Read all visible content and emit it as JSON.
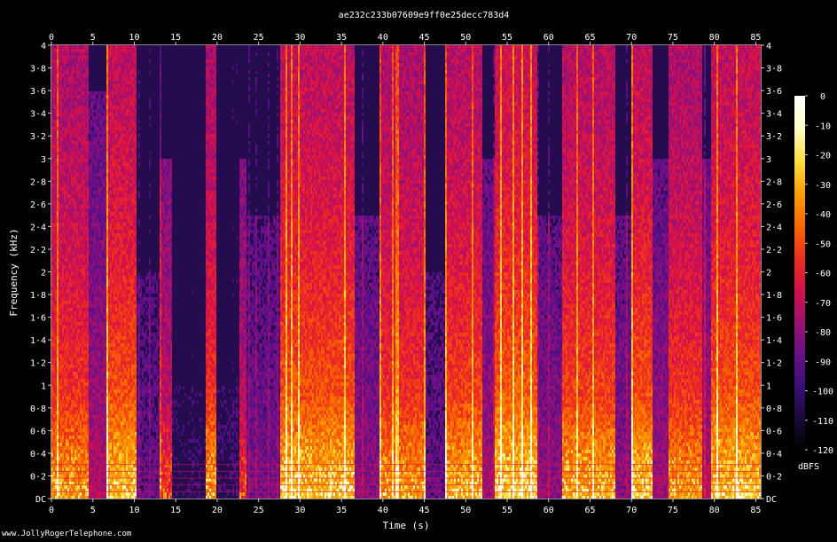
{
  "chart_data": {
    "type": "heatmap",
    "title": "ae232c233b07609e9ff0e25decc783d4",
    "xlabel": "Time (s)",
    "ylabel": "Frequency (kHz)",
    "xlim": [
      0,
      85.6
    ],
    "ylim": [
      0,
      4
    ],
    "x_ticks": [
      "0",
      "5",
      "10",
      "15",
      "20",
      "25",
      "30",
      "35",
      "40",
      "45",
      "50",
      "55",
      "60",
      "65",
      "70",
      "75",
      "80",
      "85"
    ],
    "x_tick_values": [
      0,
      5,
      10,
      15,
      20,
      25,
      30,
      35,
      40,
      45,
      50,
      55,
      60,
      65,
      70,
      75,
      80,
      85
    ],
    "y_ticks": [
      "DC",
      "0·2",
      "0·4",
      "0·6",
      "0·8",
      "1",
      "1·2",
      "1·4",
      "1·6",
      "1·8",
      "2",
      "2·2",
      "2·4",
      "2·6",
      "2·8",
      "3",
      "3·2",
      "3·4",
      "3·6",
      "3·8",
      "4"
    ],
    "y_tick_values": [
      0,
      0.2,
      0.4,
      0.6,
      0.8,
      1,
      1.2,
      1.4,
      1.6,
      1.8,
      2,
      2.2,
      2.4,
      2.6,
      2.8,
      3,
      3.2,
      3.4,
      3.6,
      3.8,
      4
    ],
    "colorbar": {
      "label": "dBFS",
      "ticks": [
        "0",
        "-10",
        "-20",
        "-30",
        "-40",
        "-50",
        "-60",
        "-70",
        "-80",
        "-90",
        "-100",
        "-110",
        "-120"
      ],
      "tick_values": [
        0,
        -10,
        -20,
        -30,
        -40,
        -50,
        -60,
        -70,
        -80,
        -90,
        -100,
        -110,
        -120
      ],
      "range": [
        -120,
        0
      ]
    },
    "colormap": [
      "#000000",
      "#1a0a3a",
      "#3a0f7a",
      "#6a0f8a",
      "#a01070",
      "#d8104a",
      "#f0301a",
      "#f86a00",
      "#fca000",
      "#fde040",
      "#ffffc8",
      "#ffffff"
    ],
    "activity": [
      {
        "start": 0.0,
        "end": 4.3,
        "level": 0.8,
        "peak_khz": 4.0
      },
      {
        "start": 4.3,
        "end": 6.5,
        "level": 0.45,
        "peak_khz": 3.6
      },
      {
        "start": 6.5,
        "end": 10.2,
        "level": 0.9,
        "peak_khz": 4.0
      },
      {
        "start": 10.2,
        "end": 13.0,
        "level": 0.25,
        "peak_khz": 2.0
      },
      {
        "start": 13.0,
        "end": 14.5,
        "level": 0.55,
        "peak_khz": 3.0
      },
      {
        "start": 14.5,
        "end": 18.5,
        "level": 0.1,
        "peak_khz": 1.0
      },
      {
        "start": 18.5,
        "end": 19.8,
        "level": 0.8,
        "peak_khz": 4.0
      },
      {
        "start": 19.8,
        "end": 22.5,
        "level": 0.12,
        "peak_khz": 1.0
      },
      {
        "start": 22.5,
        "end": 23.5,
        "level": 0.55,
        "peak_khz": 3.0
      },
      {
        "start": 23.5,
        "end": 27.5,
        "level": 0.3,
        "peak_khz": 2.5
      },
      {
        "start": 27.5,
        "end": 36.5,
        "level": 0.9,
        "peak_khz": 4.0
      },
      {
        "start": 36.5,
        "end": 39.5,
        "level": 0.35,
        "peak_khz": 2.5
      },
      {
        "start": 39.5,
        "end": 45.0,
        "level": 0.8,
        "peak_khz": 4.0
      },
      {
        "start": 45.0,
        "end": 47.5,
        "level": 0.25,
        "peak_khz": 2.0
      },
      {
        "start": 47.5,
        "end": 52.0,
        "level": 0.85,
        "peak_khz": 4.0
      },
      {
        "start": 52.0,
        "end": 53.3,
        "level": 0.4,
        "peak_khz": 3.0
      },
      {
        "start": 53.3,
        "end": 58.5,
        "level": 0.95,
        "peak_khz": 4.0
      },
      {
        "start": 58.5,
        "end": 61.5,
        "level": 0.35,
        "peak_khz": 2.5
      },
      {
        "start": 61.5,
        "end": 68.0,
        "level": 0.85,
        "peak_khz": 4.0
      },
      {
        "start": 68.0,
        "end": 69.8,
        "level": 0.35,
        "peak_khz": 2.5
      },
      {
        "start": 69.8,
        "end": 72.5,
        "level": 0.9,
        "peak_khz": 4.0
      },
      {
        "start": 72.5,
        "end": 74.3,
        "level": 0.4,
        "peak_khz": 3.0
      },
      {
        "start": 74.3,
        "end": 78.5,
        "level": 0.8,
        "peak_khz": 4.0
      },
      {
        "start": 78.5,
        "end": 79.5,
        "level": 0.45,
        "peak_khz": 3.0
      },
      {
        "start": 79.5,
        "end": 85.6,
        "level": 0.9,
        "peak_khz": 4.0
      }
    ]
  },
  "credit": "www.JollyRogerTelephone.com"
}
